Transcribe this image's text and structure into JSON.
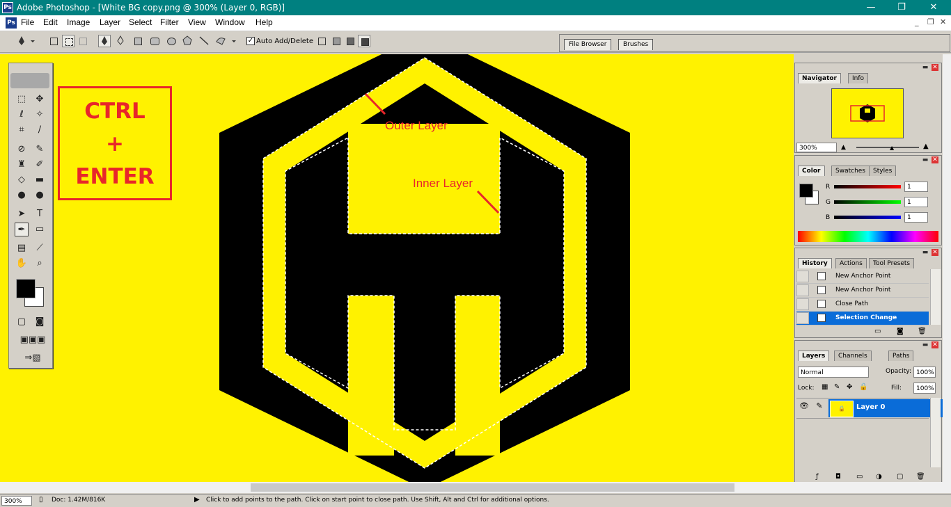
{
  "window": {
    "title": "Adobe Photoshop - [White BG copy.png @ 300% (Layer 0, RGB)]",
    "minimize": "—",
    "maximize": "❐",
    "close": "✕"
  },
  "menu": {
    "items": [
      "File",
      "Edit",
      "Image",
      "Layer",
      "Select",
      "Filter",
      "View",
      "Window",
      "Help"
    ],
    "doc_min": "_",
    "doc_restore": "❐",
    "doc_close": "✕"
  },
  "options_bar": {
    "auto_add_delete": "Auto Add/Delete",
    "auto_add_delete_checked": true
  },
  "palette_well": {
    "tabs": [
      "File Browser",
      "Brushes"
    ]
  },
  "canvas": {
    "background_color": "#fff200",
    "shortcut_box": {
      "line1": "CTRL",
      "line2": "+",
      "line3": "ENTER",
      "color": "#e8262a"
    },
    "annotations": {
      "outer": "Outer Layer",
      "inner": "Inner Layer",
      "color": "#e8262a"
    }
  },
  "navigator": {
    "tabs": [
      "Navigator",
      "Info"
    ],
    "zoom": "300%"
  },
  "color": {
    "tabs": [
      "Color",
      "Swatches",
      "Styles"
    ],
    "channels": [
      {
        "label": "R",
        "value": "1"
      },
      {
        "label": "G",
        "value": "1"
      },
      {
        "label": "B",
        "value": "1"
      }
    ]
  },
  "history": {
    "tabs": [
      "History",
      "Actions",
      "Tool Presets"
    ],
    "items": [
      "New Anchor Point",
      "New Anchor Point",
      "Close Path",
      "Selection Change"
    ],
    "selected_index": 3
  },
  "layers": {
    "tabs": [
      "Layers",
      "Channels",
      "Paths"
    ],
    "blend_mode": "Normal",
    "opacity_label": "Opacity:",
    "opacity": "100%",
    "lock_label": "Lock:",
    "fill_label": "Fill:",
    "fill": "100%",
    "layer_name": "Layer 0"
  },
  "status": {
    "zoom": "300%",
    "doc": "Doc: 1.42M/816K",
    "hint": "Click to add points to the path.  Click on start point to close path.  Use Shift, Alt and Ctrl for additional options."
  },
  "colors": {
    "accent_selection": "#0a6cd8",
    "titlebar": "#008080"
  }
}
